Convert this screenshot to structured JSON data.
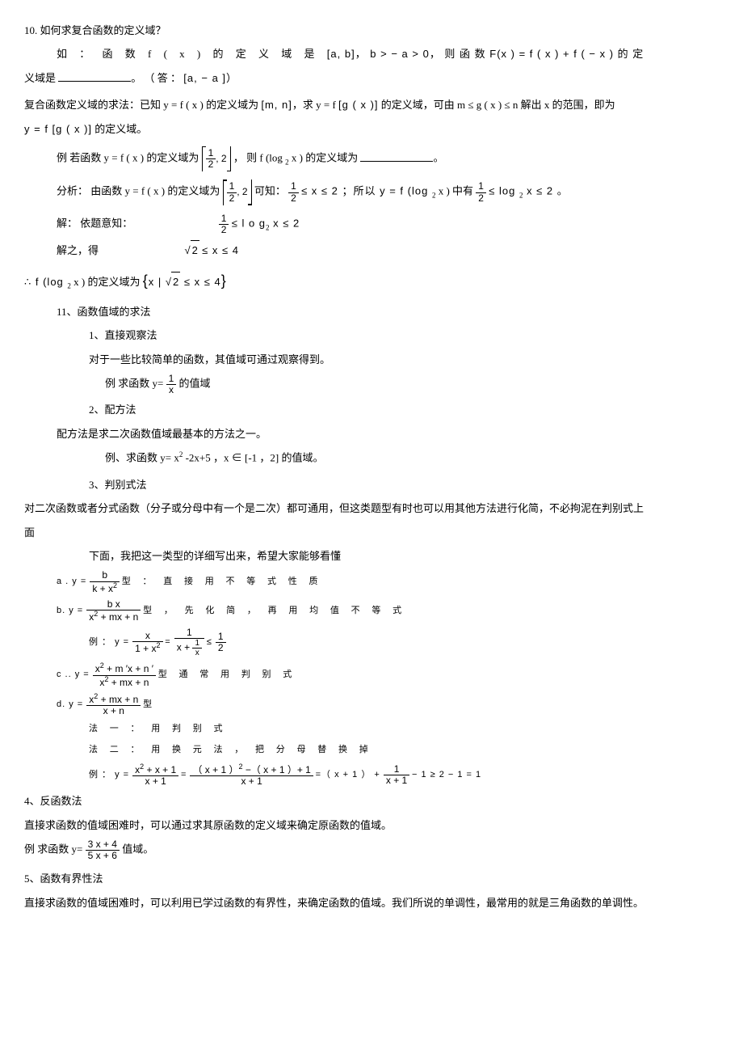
{
  "q10": {
    "title": "10. 如何求复合函数的定义域？",
    "line1_a": "如 ： 函 数 f ( x ) 的 定 义 域 是 ",
    "line1_b": "a,   b",
    "line1_c": "，  b  >  − a  >  0，   则 函 数  F(x  )  =  f ( x )  +  f  ( − x ) 的  定",
    "line2_a": "义域是 ",
    "line2_b": "。          （ 答 ：   ",
    "line2_c": "a,     − a ",
    "line2_d": "）",
    "line3_a": "复合函数定义域的求法：已知     y  =  f ( x ) 的定义域为   ",
    "line3_b": "m, n",
    "line3_c": "，求  y   =   f  ",
    "line3_d": "g ( x )",
    "line3_e": " 的定义域，可由    m  ≤  g ( x )  ≤  n  解出  x  的范围，即为",
    "line4_a": "y   =   f  ",
    "line4_b": "g ( x )",
    "line4_c": " 的定义域。",
    "ex_a": "例      若函数  y  =  f ( x ) 的定义域为   ",
    "ex_frac_n": "1",
    "ex_frac_d": "2",
    "ex_frac_after": ", 2",
    "ex_b": "，  则  f (log ",
    "ex_sub": "2",
    "ex_c": " x ) 的定义域为  ",
    "ex_d": "。",
    "ana_a": "分析：   由函数  y   =  f  ( x ) 的定义域为   ",
    "ana_b": " 可知：   ",
    "ana_frac2_n": "1",
    "ana_frac2_d": "2",
    "ana_c": "  ≤  x  ≤  2  ；所以  y   =   f  (log ",
    "ana_d": " x ) 中有 ",
    "ana_e": "  ≤ log ",
    "ana_f": " x  ≤  2  。",
    "sol_a": "解：  依题意知：",
    "sol_expr": "  ≤  l o g",
    "sol_expr2": " x  ≤  2",
    "sol2_a": "解之，得",
    "sol2_expr": "  ≤  x  ≤  4",
    "conc_a": "∴      f (log ",
    "conc_b": " x ) 的定义域为   ",
    "conc_set_a": "x  | ",
    "conc_set_b": "  ≤  x  ≤  4"
  },
  "q11": {
    "title": "11、函数值域的求法",
    "m1_t": "1、直接观察法",
    "m1_p": "对于一些比较简单的函数，其值域可通过观察得到。",
    "m1_ex_a": "例  求函数  y= ",
    "m1_ex_n": "1",
    "m1_ex_d": "x",
    "m1_ex_b": " 的值域",
    "m2_t": "2、配方法",
    "m2_p": "配方法是求二次函数值域最基本的方法之一。",
    "m2_ex": "例、求函数   y= x",
    "m2_ex_sup": "2",
    "m2_ex_b": " -2x+5 ，x ∈ [-1 ，2] 的值域。",
    "m3_t": "3、判别式法",
    "m3_p": "对二次函数或者分式函数（分子或分母中有一个是二次）都可通用，但这类题型有时也可以用其他方法进行化简，不必拘泥在判别式上",
    "m3_p2": "面",
    "m3_intro": "下面，我把这一类型的详细写出来，希望大家能够看懂",
    "a_a": "a .     y   =  ",
    "a_n": "b",
    "a_d": "k  + x",
    "a_b": " 型  ：  直  接  用  不  等  式  性  质",
    "b_a": "b.      y   =  ",
    "b_n": "b x",
    "b_d": "x",
    "b_d2": "  +  mx   +  n",
    "b_b": " 型 ， 先  化  简 ，   再  用  均  值  不  等  式",
    "b_ex_a": "例  ：   y   =  ",
    "b_ex_n1": "x",
    "b_ex_d1_a": "1 + x",
    "b_ex_eq": "  =  ",
    "b_ex_n2": "1",
    "b_ex_d2_a": "x  +  ",
    "b_ex_d2_n": "1",
    "b_ex_d2_d": "x",
    "b_ex_le": "  ≤ ",
    "b_ex_n3": "1",
    "b_ex_d3": "2",
    "c_a": "c ..     y   =  ",
    "c_n_a": "x",
    "c_n_b": "  +  m ′x   +  n ′",
    "c_d_a": "x",
    "c_d_b": "  +  mx   + n",
    "c_b": " 型    通  常  用  判  别  式",
    "d_a": "d.      y   =  ",
    "d_n_a": "x",
    "d_n_b": "  +  mx   +  n",
    "d_d": "x   +  n",
    "d_b": " 型",
    "d_m1": "法   一   ：   用  判  别  式",
    "d_m2": "法   二  ：  用  换  元  法  ，   把  分  母  替  换  掉",
    "d_ex_a": "例  ：  y   =  ",
    "d_ex_n1_a": "x",
    "d_ex_n1_b": "  + x   + 1",
    "d_ex_d1": "x   + 1",
    "d_ex_n2": "（ x + 1 ）",
    "d_ex_n2b": "  −（ x  + 1 ）+ 1",
    "d_ex_d2": "x   + 1",
    "d_ex_eq2": "  =（ x + 1 ）  +  ",
    "d_ex_n3": "1",
    "d_ex_d3": "x  + 1",
    "d_ex_tail": "  − 1  ≥  2  − 1   =  1",
    "m4_t": "4、反函数法",
    "m4_p": "直接求函数的值域困难时，可以通过求其原函数的定义域来确定原函数的值域。",
    "m4_ex_a": "例  求函数  y= ",
    "m4_n": "3 x  + 4",
    "m4_d": "5 x  + 6",
    "m4_ex_b": " 值域。",
    "m5_t": "5、函数有界性法",
    "m5_p": "直接求函数的值域困难时，可以利用已学过函数的有界性，来确定函数的值域。我们所说的单调性，最常用的就是三角函数的单调性。"
  }
}
